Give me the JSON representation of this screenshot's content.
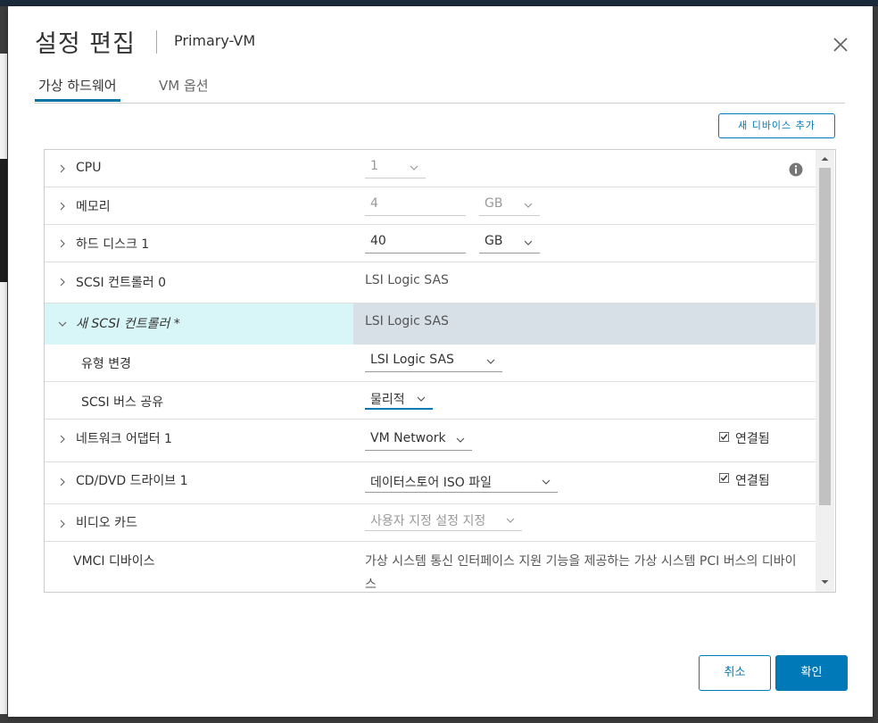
{
  "dialog": {
    "title": "설정 편집",
    "subtitle": "Primary-VM"
  },
  "tabs": [
    {
      "label": "가상 하드웨어",
      "active": true
    },
    {
      "label": "VM 옵션",
      "active": false
    }
  ],
  "add_device_label": "새 디바이스 추가",
  "rows": {
    "cpu": {
      "label": "CPU",
      "value": "1"
    },
    "memory": {
      "label": "메모리",
      "value": "4",
      "unit": "GB"
    },
    "disk": {
      "label": "하드 디스크 1",
      "value": "40",
      "unit": "GB"
    },
    "scsi0": {
      "label": "SCSI 컨트롤러 0",
      "value": "LSI Logic SAS"
    },
    "new_scsi": {
      "label": "새 SCSI 컨트롤러 *",
      "value": "LSI Logic SAS"
    },
    "type_change": {
      "label": "유형 변경",
      "value": "LSI Logic SAS"
    },
    "bus_share": {
      "label": "SCSI 버스 공유",
      "value": "물리적"
    },
    "network": {
      "label": "네트워크 어댑터 1",
      "value": "VM Network",
      "connected_label": "연결됨",
      "connected": true
    },
    "cddvd": {
      "label": "CD/DVD 드라이브 1",
      "value": "데이터스토어 ISO 파일",
      "connected_label": "연결됨",
      "connected": true
    },
    "video": {
      "label": "비디오 카드",
      "value": "사용자 지정 설정 지정"
    },
    "vmci": {
      "label": "VMCI 디바이스",
      "value": "가상 시스템 통신 인터페이스 지원 기능을 제공하는 가상 시스템 PCI 버스의 디바이스"
    }
  },
  "buttons": {
    "cancel": "취소",
    "ok": "확인"
  },
  "colors": {
    "accent": "#0079b8",
    "selected_row_left": "#d8f6f7",
    "selected_row_right": "#d7e0e6"
  },
  "icons": [
    "close-icon",
    "info-icon",
    "chevron-right-icon",
    "chevron-down-icon",
    "checkbox-icon"
  ]
}
